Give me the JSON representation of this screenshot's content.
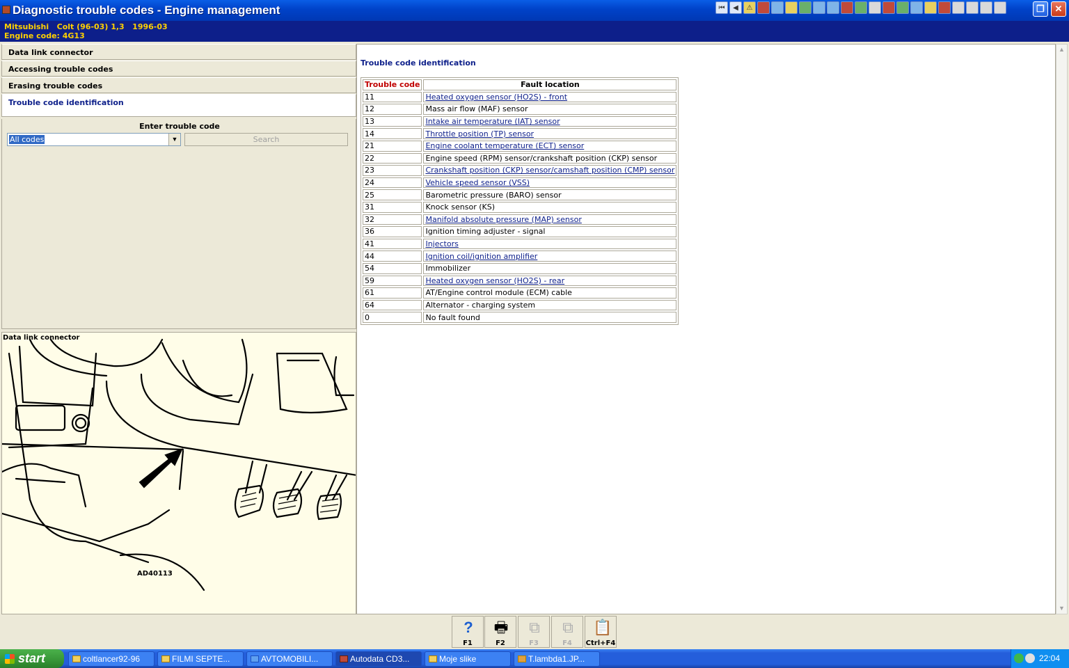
{
  "window": {
    "title": "Diagnostic trouble codes - Engine management",
    "restore_icon": "restore-icon",
    "close_icon": "close-icon"
  },
  "vehicle": {
    "line1": "Mitsubishi   Colt (96-03) 1,3   1996-03",
    "line2": "Engine code: 4G13"
  },
  "nav": {
    "items": [
      {
        "label": "Data link connector"
      },
      {
        "label": "Accessing trouble codes"
      },
      {
        "label": "Erasing trouble codes"
      },
      {
        "label": "Trouble code identification"
      }
    ]
  },
  "search": {
    "enter_label": "Enter trouble code",
    "selected_value": "All codes",
    "button_label": "Search"
  },
  "illustration": {
    "title": "Data link connector",
    "code": "AD40113"
  },
  "content": {
    "heading": "Trouble code identification",
    "col_code": "Trouble code",
    "col_location": "Fault location",
    "rows": [
      {
        "code": "11",
        "location": "Heated oxygen sensor (HO2S) - front",
        "link": true
      },
      {
        "code": "12",
        "location": "Mass air flow (MAF) sensor",
        "link": false
      },
      {
        "code": "13",
        "location": "Intake air temperature (IAT) sensor",
        "link": true
      },
      {
        "code": "14",
        "location": "Throttle position (TP) sensor",
        "link": true
      },
      {
        "code": "21",
        "location": "Engine coolant temperature (ECT) sensor",
        "link": true
      },
      {
        "code": "22",
        "location": "Engine speed (RPM) sensor/crankshaft position (CKP) sensor",
        "link": false
      },
      {
        "code": "23",
        "location": "Crankshaft position (CKP) sensor/camshaft position (CMP) sensor",
        "link": true
      },
      {
        "code": "24",
        "location": "Vehicle speed sensor (VSS)",
        "link": true
      },
      {
        "code": "25",
        "location": "Barometric pressure (BARO) sensor",
        "link": false
      },
      {
        "code": "31",
        "location": "Knock sensor (KS)",
        "link": false
      },
      {
        "code": "32",
        "location": "Manifold absolute pressure (MAP) sensor",
        "link": true
      },
      {
        "code": "36",
        "location": "Ignition timing adjuster - signal",
        "link": false
      },
      {
        "code": "41",
        "location": "Injectors",
        "link": true
      },
      {
        "code": "44",
        "location": "Ignition coil/ignition amplifier",
        "link": true
      },
      {
        "code": "54",
        "location": "Immobilizer",
        "link": false
      },
      {
        "code": "59",
        "location": "Heated oxygen sensor (HO2S) - rear",
        "link": true
      },
      {
        "code": "61",
        "location": "AT/Engine control module (ECM) cable",
        "link": false
      },
      {
        "code": "64",
        "location": "Alternator - charging system",
        "link": false
      },
      {
        "code": "0",
        "location": "No fault found",
        "link": false
      }
    ]
  },
  "function_keys": [
    {
      "label": "F1",
      "icon": "help-icon",
      "enabled": true
    },
    {
      "label": "F2",
      "icon": "print-icon",
      "enabled": true
    },
    {
      "label": "F3",
      "icon": "copy-icon",
      "enabled": false
    },
    {
      "label": "F4",
      "icon": "copy-icon",
      "enabled": false
    },
    {
      "label": "Ctrl+F4",
      "icon": "notes-icon",
      "enabled": true
    }
  ],
  "taskbar": {
    "start_label": "start",
    "items": [
      {
        "label": "coltlancer92-96",
        "active": false
      },
      {
        "label": "FILMI SEPTE...",
        "active": false
      },
      {
        "label": "AVTOMOBILI...",
        "active": false
      },
      {
        "label": "Autodata CD3...",
        "active": true
      },
      {
        "label": "Moje slike",
        "active": false
      },
      {
        "label": "T.lambda1.JP...",
        "active": false
      }
    ],
    "clock": "22:04"
  }
}
